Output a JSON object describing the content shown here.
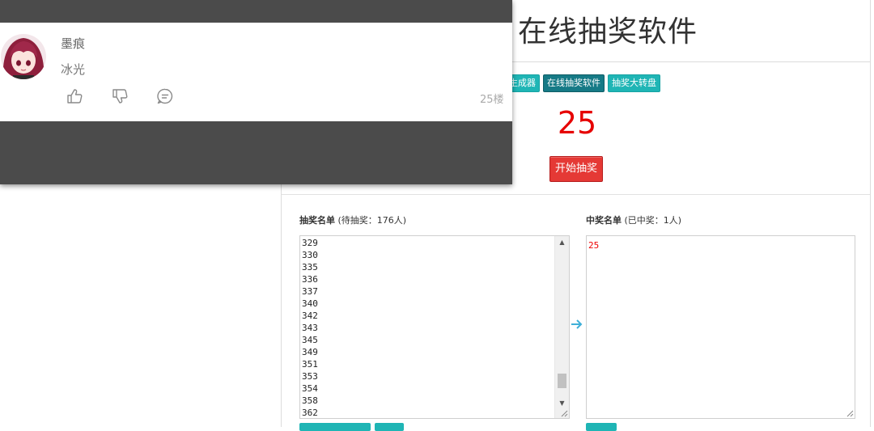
{
  "page": {
    "title": "在线抽奖软件",
    "tabs": [
      "生成器",
      "在线抽奖软件",
      "抽奖大转盘"
    ],
    "result": "25",
    "draw_button": "开始抽奖",
    "pending": {
      "title": "抽奖名单",
      "count_text": "(待抽奖：176人)"
    },
    "winners": {
      "title": "中奖名单",
      "count_text": "(已中奖：1人)"
    },
    "pending_items": [
      "329",
      "330",
      "335",
      "336",
      "337",
      "340",
      "342",
      "343",
      "345",
      "349",
      "351",
      "353",
      "354",
      "358",
      "362"
    ],
    "winner_items": [
      "25"
    ]
  },
  "comment": {
    "username": "墨痕",
    "text": "冰光",
    "floor": "25楼",
    "icons": [
      "thumbs-up-icon",
      "thumbs-down-icon",
      "reply-icon"
    ]
  },
  "colors": {
    "accent_teal": "#1fb5b5",
    "active_tab": "#167a86",
    "draw_red": "#e53935",
    "result_red": "#e60000",
    "overlay_gray": "#4b4b4b"
  }
}
